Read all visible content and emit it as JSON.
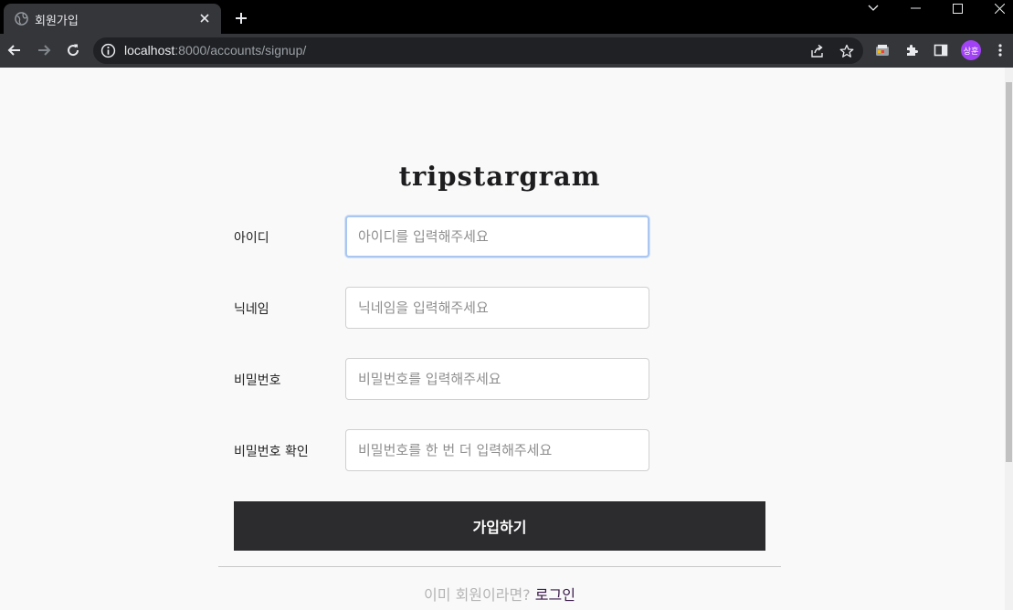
{
  "browser": {
    "tab_title": "회원가입",
    "url_host": "localhost",
    "url_path": ":8000/accounts/signup/",
    "profile_initials": "상훈"
  },
  "page": {
    "logo": "tripstargram",
    "fields": [
      {
        "label": "아이디",
        "placeholder": "아이디를 입력해주세요"
      },
      {
        "label": "닉네임",
        "placeholder": "닉네임을 입력해주세요"
      },
      {
        "label": "비밀번호",
        "placeholder": "비밀번호를 입력해주세요"
      },
      {
        "label": "비밀번호 확인",
        "placeholder": "비밀번호를 한 번 더 입력해주세요"
      }
    ],
    "submit_label": "가입하기",
    "footer_text": "이미 회원이라면?",
    "footer_link": "로그인"
  },
  "colors": {
    "button_bg": "#2c2c2f",
    "focus_border": "#a9c7f0",
    "link": "#3b1a4b",
    "profile": "#a142f4"
  }
}
